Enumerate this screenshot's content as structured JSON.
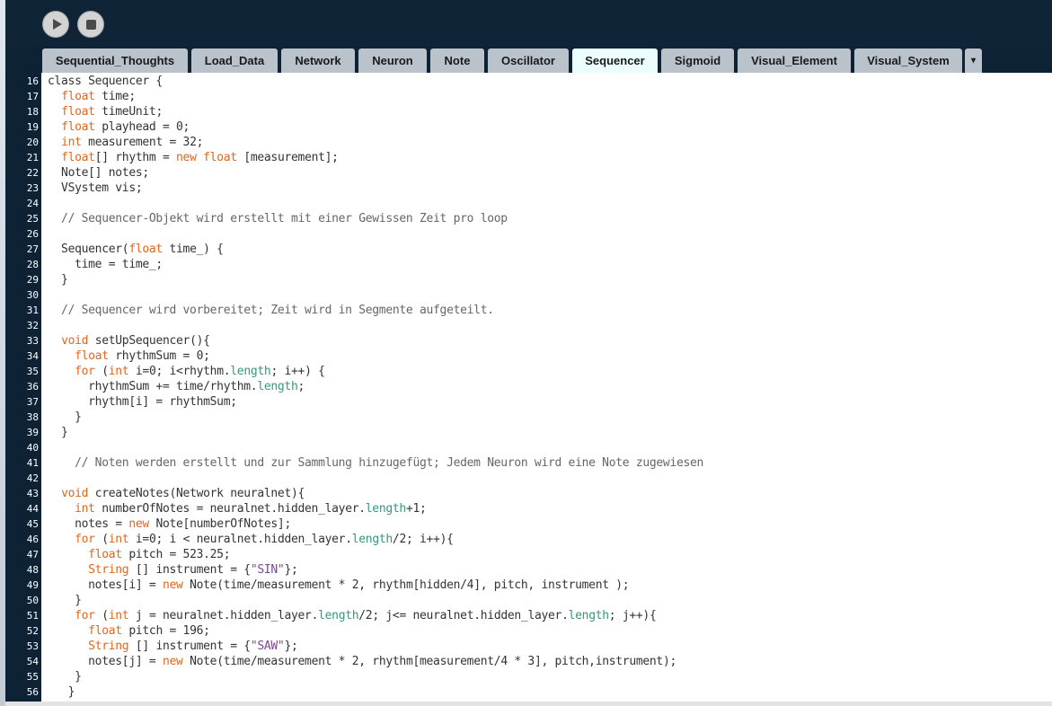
{
  "toolbar": {
    "run_icon": "play-icon",
    "stop_icon": "stop-icon"
  },
  "tabs": [
    {
      "label": "Sequential_Thoughts",
      "active": false
    },
    {
      "label": "Load_Data",
      "active": false
    },
    {
      "label": "Network",
      "active": false
    },
    {
      "label": "Neuron",
      "active": false
    },
    {
      "label": "Note",
      "active": false
    },
    {
      "label": "Oscillator",
      "active": false
    },
    {
      "label": "Sequencer",
      "active": true
    },
    {
      "label": "Sigmoid",
      "active": false
    },
    {
      "label": "Visual_Element",
      "active": false
    },
    {
      "label": "Visual_System",
      "active": false
    }
  ],
  "tabs_more": "▾",
  "colors": {
    "keyword": "#e2661a",
    "string": "#7d4793",
    "property": "#33997e",
    "comment": "#666666",
    "active_tab": "#ecfdfd",
    "background": "#0e2235"
  },
  "lines": [
    {
      "n": "16",
      "segs": [
        [
          "class Sequencer {",
          ""
        ]
      ]
    },
    {
      "n": "17",
      "segs": [
        [
          "  ",
          ""
        ],
        [
          "float",
          "kw"
        ],
        [
          " time;",
          ""
        ]
      ]
    },
    {
      "n": "18",
      "segs": [
        [
          "  ",
          ""
        ],
        [
          "float",
          "kw"
        ],
        [
          " timeUnit;",
          ""
        ]
      ]
    },
    {
      "n": "19",
      "segs": [
        [
          "  ",
          ""
        ],
        [
          "float",
          "kw"
        ],
        [
          " playhead = 0;",
          ""
        ]
      ]
    },
    {
      "n": "20",
      "segs": [
        [
          "  ",
          ""
        ],
        [
          "int",
          "kw"
        ],
        [
          " measurement = 32;",
          ""
        ]
      ]
    },
    {
      "n": "21",
      "segs": [
        [
          "  ",
          ""
        ],
        [
          "float",
          "kw"
        ],
        [
          "[] rhythm = ",
          ""
        ],
        [
          "new",
          "kw"
        ],
        [
          " ",
          ""
        ],
        [
          "float",
          "kw"
        ],
        [
          " [measurement];",
          ""
        ]
      ]
    },
    {
      "n": "22",
      "segs": [
        [
          "  Note[] notes;",
          ""
        ]
      ]
    },
    {
      "n": "23",
      "segs": [
        [
          "  VSystem vis;",
          ""
        ]
      ]
    },
    {
      "n": "24",
      "segs": [
        [
          "",
          ""
        ]
      ]
    },
    {
      "n": "25",
      "segs": [
        [
          "  // Sequencer-Objekt wird erstellt mit einer Gewissen Zeit pro loop",
          "cm"
        ]
      ]
    },
    {
      "n": "26",
      "segs": [
        [
          "",
          ""
        ]
      ]
    },
    {
      "n": "27",
      "segs": [
        [
          "  Sequencer(",
          ""
        ],
        [
          "float",
          "kw"
        ],
        [
          " time_) {",
          ""
        ]
      ]
    },
    {
      "n": "28",
      "segs": [
        [
          "    time = time_;",
          ""
        ]
      ]
    },
    {
      "n": "29",
      "segs": [
        [
          "  }",
          ""
        ]
      ]
    },
    {
      "n": "30",
      "segs": [
        [
          "",
          ""
        ]
      ]
    },
    {
      "n": "31",
      "segs": [
        [
          "  // Sequencer wird vorbereitet; Zeit wird in Segmente aufgeteilt.",
          "cm"
        ]
      ]
    },
    {
      "n": "32",
      "segs": [
        [
          "",
          ""
        ]
      ]
    },
    {
      "n": "33",
      "segs": [
        [
          "  ",
          ""
        ],
        [
          "void",
          "kw"
        ],
        [
          " setUpSequencer(){",
          ""
        ]
      ]
    },
    {
      "n": "34",
      "segs": [
        [
          "    ",
          ""
        ],
        [
          "float",
          "kw"
        ],
        [
          " rhythmSum = 0;",
          ""
        ]
      ]
    },
    {
      "n": "35",
      "segs": [
        [
          "    ",
          ""
        ],
        [
          "for",
          "kw"
        ],
        [
          " (",
          ""
        ],
        [
          "int",
          "kw"
        ],
        [
          " i=0; i<rhythm.",
          ""
        ],
        [
          "length",
          "prop"
        ],
        [
          "; i++) {",
          ""
        ]
      ]
    },
    {
      "n": "36",
      "segs": [
        [
          "      rhythmSum += time/rhythm.",
          ""
        ],
        [
          "length",
          "prop"
        ],
        [
          ";",
          ""
        ]
      ]
    },
    {
      "n": "37",
      "segs": [
        [
          "      rhythm[i] = rhythmSum;",
          ""
        ]
      ]
    },
    {
      "n": "38",
      "segs": [
        [
          "    }",
          ""
        ]
      ]
    },
    {
      "n": "39",
      "segs": [
        [
          "  }",
          ""
        ]
      ]
    },
    {
      "n": "40",
      "segs": [
        [
          "",
          ""
        ]
      ]
    },
    {
      "n": "41",
      "segs": [
        [
          "    // Noten werden erstellt und zur Sammlung hinzugefügt; Jedem Neuron wird eine Note zugewiesen",
          "cm"
        ]
      ]
    },
    {
      "n": "42",
      "segs": [
        [
          "",
          ""
        ]
      ]
    },
    {
      "n": "43",
      "segs": [
        [
          "  ",
          ""
        ],
        [
          "void",
          "kw"
        ],
        [
          " createNotes(Network neuralnet){",
          ""
        ]
      ]
    },
    {
      "n": "44",
      "segs": [
        [
          "    ",
          ""
        ],
        [
          "int",
          "kw"
        ],
        [
          " numberOfNotes = neuralnet.hidden_layer.",
          ""
        ],
        [
          "length",
          "prop"
        ],
        [
          "+1;",
          ""
        ]
      ]
    },
    {
      "n": "45",
      "segs": [
        [
          "    notes = ",
          ""
        ],
        [
          "new",
          "kw"
        ],
        [
          " Note[numberOfNotes];",
          ""
        ]
      ]
    },
    {
      "n": "46",
      "segs": [
        [
          "    ",
          ""
        ],
        [
          "for",
          "kw"
        ],
        [
          " (",
          ""
        ],
        [
          "int",
          "kw"
        ],
        [
          " i=0; i < neuralnet.hidden_layer.",
          ""
        ],
        [
          "length",
          "prop"
        ],
        [
          "/2; i++){",
          ""
        ]
      ]
    },
    {
      "n": "47",
      "segs": [
        [
          "      ",
          ""
        ],
        [
          "float",
          "kw"
        ],
        [
          " pitch = 523.25;",
          ""
        ]
      ]
    },
    {
      "n": "48",
      "segs": [
        [
          "      ",
          ""
        ],
        [
          "String",
          "kw"
        ],
        [
          " [] instrument = {",
          ""
        ],
        [
          "\"SIN\"",
          "str"
        ],
        [
          "};",
          ""
        ]
      ]
    },
    {
      "n": "49",
      "segs": [
        [
          "      notes[i] = ",
          ""
        ],
        [
          "new",
          "kw"
        ],
        [
          " Note(time/measurement * 2, rhythm[hidden/4], pitch, instrument );",
          ""
        ]
      ]
    },
    {
      "n": "50",
      "segs": [
        [
          "    }",
          ""
        ]
      ]
    },
    {
      "n": "51",
      "segs": [
        [
          "    ",
          ""
        ],
        [
          "for",
          "kw"
        ],
        [
          " (",
          ""
        ],
        [
          "int",
          "kw"
        ],
        [
          " j = neuralnet.hidden_layer.",
          ""
        ],
        [
          "length",
          "prop"
        ],
        [
          "/2; j<= neuralnet.hidden_layer.",
          ""
        ],
        [
          "length",
          "prop"
        ],
        [
          "; j++){",
          ""
        ]
      ]
    },
    {
      "n": "52",
      "segs": [
        [
          "      ",
          ""
        ],
        [
          "float",
          "kw"
        ],
        [
          " pitch = 196;",
          ""
        ]
      ]
    },
    {
      "n": "53",
      "segs": [
        [
          "      ",
          ""
        ],
        [
          "String",
          "kw"
        ],
        [
          " [] instrument = {",
          ""
        ],
        [
          "\"SAW\"",
          "str"
        ],
        [
          "};",
          ""
        ]
      ]
    },
    {
      "n": "54",
      "segs": [
        [
          "      notes[j] = ",
          ""
        ],
        [
          "new",
          "kw"
        ],
        [
          " Note(time/measurement * 2, rhythm[measurement/4 * 3], pitch,instrument);",
          ""
        ]
      ]
    },
    {
      "n": "55",
      "segs": [
        [
          "    }",
          ""
        ]
      ]
    },
    {
      "n": "56",
      "segs": [
        [
          "   }",
          ""
        ]
      ]
    }
  ]
}
